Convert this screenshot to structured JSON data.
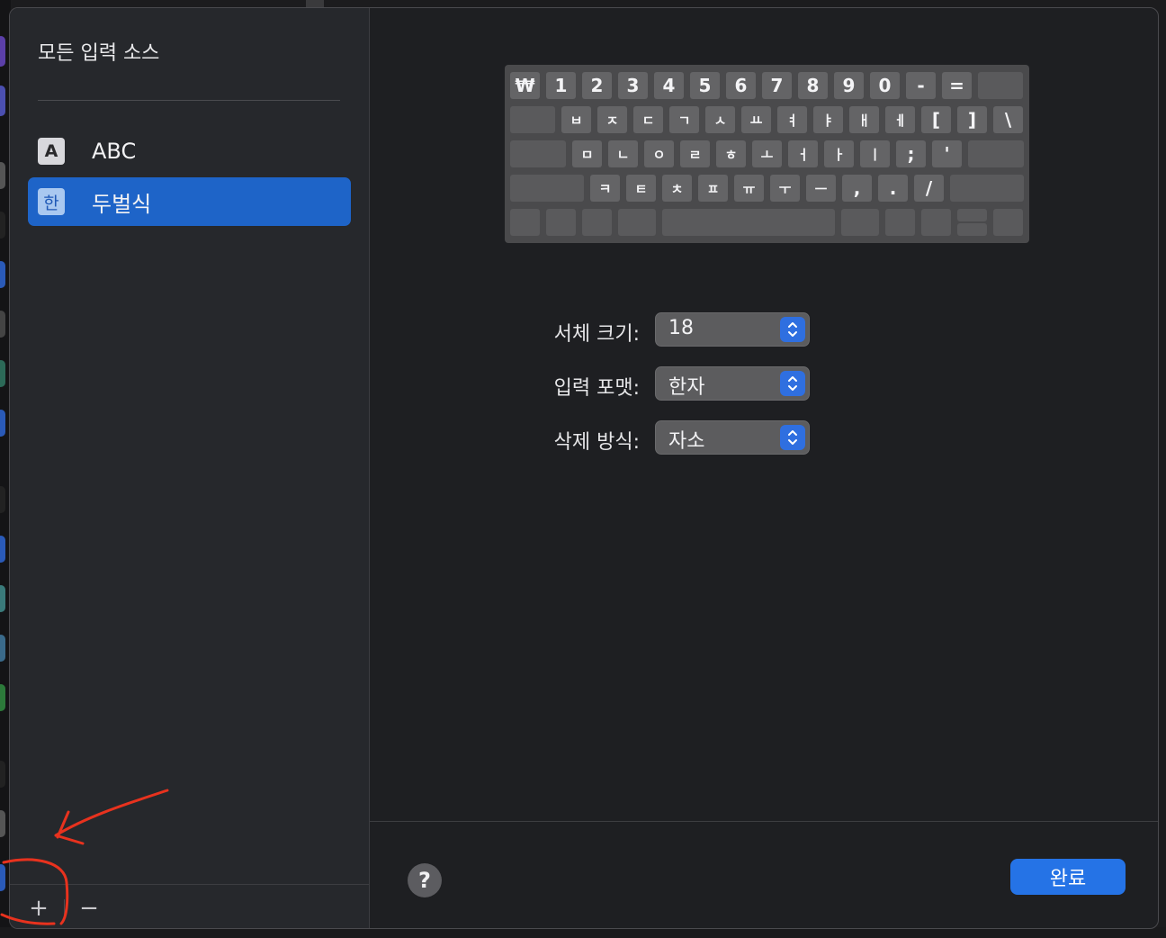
{
  "sidebar": {
    "title": "모든 입력 소스",
    "items": [
      {
        "icon_text": "A",
        "icon_name": "abc-input-icon",
        "label": "ABC",
        "selected": false
      },
      {
        "icon_text": "한",
        "icon_name": "hangul-input-icon",
        "label": "두벌식",
        "selected": true
      }
    ],
    "add_label": "+",
    "remove_label": "−"
  },
  "keyboard": {
    "rows": [
      [
        "₩",
        "1",
        "2",
        "3",
        "4",
        "5",
        "6",
        "7",
        "8",
        "9",
        "0",
        "-",
        "=",
        ""
      ],
      [
        "",
        "ㅂ",
        "ㅈ",
        "ㄷ",
        "ㄱ",
        "ㅅ",
        "ㅛ",
        "ㅕ",
        "ㅑ",
        "ㅐ",
        "ㅔ",
        "[",
        "]",
        "\\"
      ],
      [
        "",
        "ㅁ",
        "ㄴ",
        "ㅇ",
        "ㄹ",
        "ㅎ",
        "ㅗ",
        "ㅓ",
        "ㅏ",
        "ㅣ",
        ";",
        "'",
        ""
      ],
      [
        "",
        "ㅋ",
        "ㅌ",
        "ㅊ",
        "ㅍ",
        "ㅠ",
        "ㅜ",
        "ㅡ",
        ",",
        ".",
        "/",
        ""
      ]
    ]
  },
  "settings": [
    {
      "label": "서체 크기:",
      "value": "18"
    },
    {
      "label": "입력 포맷:",
      "value": "한자"
    },
    {
      "label": "삭제 방식:",
      "value": "자소"
    }
  ],
  "footer": {
    "help_label": "?",
    "done_label": "완료"
  },
  "colors": {
    "accent": "#2573e6",
    "selection": "#1e64c8",
    "annotation": "#e8321e"
  }
}
